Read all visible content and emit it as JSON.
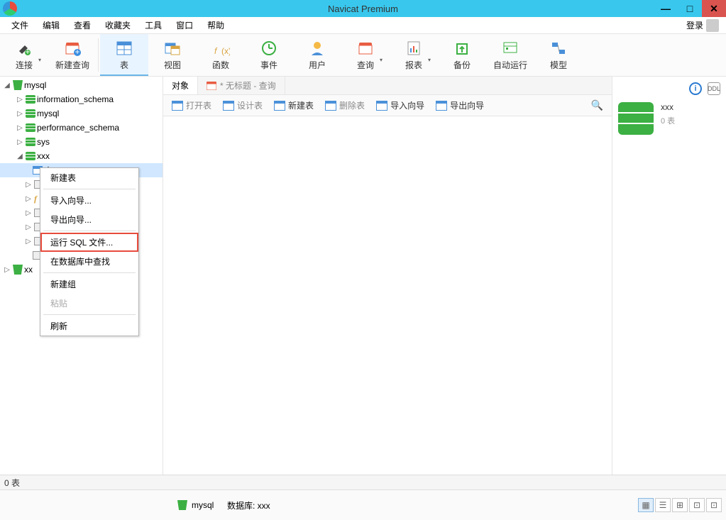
{
  "titlebar": {
    "title": "Navicat Premium"
  },
  "menubar": {
    "items": [
      "文件",
      "编辑",
      "查看",
      "收藏夹",
      "工具",
      "窗口",
      "帮助"
    ],
    "login": "登录"
  },
  "toolbar": {
    "connect": "连接",
    "newquery": "新建查询",
    "table": "表",
    "view": "视图",
    "function": "函数",
    "event": "事件",
    "user": "用户",
    "query": "查询",
    "report": "报表",
    "backup": "备份",
    "autorun": "自动运行",
    "model": "模型"
  },
  "tree": {
    "conn1": "mysql",
    "db_info": "information_schema",
    "db_mysql": "mysql",
    "db_perf": "performance_schema",
    "db_sys": "sys",
    "db_xxx": "xxx",
    "node_table": "表",
    "conn2": "xx"
  },
  "contextmenu": {
    "newtable": "新建表",
    "importwiz": "导入向导...",
    "exportwiz": "导出向导...",
    "runsql": "运行 SQL 文件...",
    "findindb": "在数据库中查找",
    "newgroup": "新建组",
    "paste": "粘贴",
    "refresh": "刷新"
  },
  "tabs": {
    "objects": "对象",
    "untitled": "* 无标题 - 查询"
  },
  "objbar": {
    "opentable": "打开表",
    "designtable": "设计表",
    "newtable": "新建表",
    "deletetable": "删除表",
    "importwiz": "导入向导",
    "exportwiz": "导出向导"
  },
  "rightpane": {
    "ddl": "DDL",
    "name": "xxx",
    "count": "0 表"
  },
  "status1": {
    "text": "0 表"
  },
  "status2": {
    "conn": "mysql",
    "db": "数据库: xxx"
  }
}
